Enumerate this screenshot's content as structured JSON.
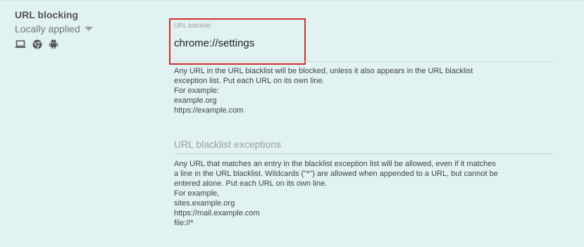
{
  "policy": {
    "title": "URL blocking",
    "scope_label": "Locally applied",
    "platform_icons": [
      "laptop-icon",
      "chrome-icon",
      "android-icon"
    ]
  },
  "blacklist": {
    "label": "URL blacklist",
    "value": "chrome://settings",
    "description": [
      "Any URL in the URL blacklist will be blocked, unless it also appears in the URL blacklist",
      "exception list. Put each URL on its own line.",
      "For example:",
      "example.org",
      "https://example.com"
    ]
  },
  "exceptions": {
    "label": "URL blacklist exceptions",
    "description": [
      "Any URL that matches an entry in the blacklist exception list will be allowed, even if it matches",
      "a line in the URL blacklist. Wildcards (\"*\") are allowed when appended to a URL, but cannot be",
      "entered alone. Put each URL on its own line.",
      "For example,",
      "sites.example.org",
      "https://mail.example.com",
      "file://*"
    ]
  },
  "colors": {
    "background": "#e0f2f1",
    "highlight_border": "#d32f2f"
  }
}
